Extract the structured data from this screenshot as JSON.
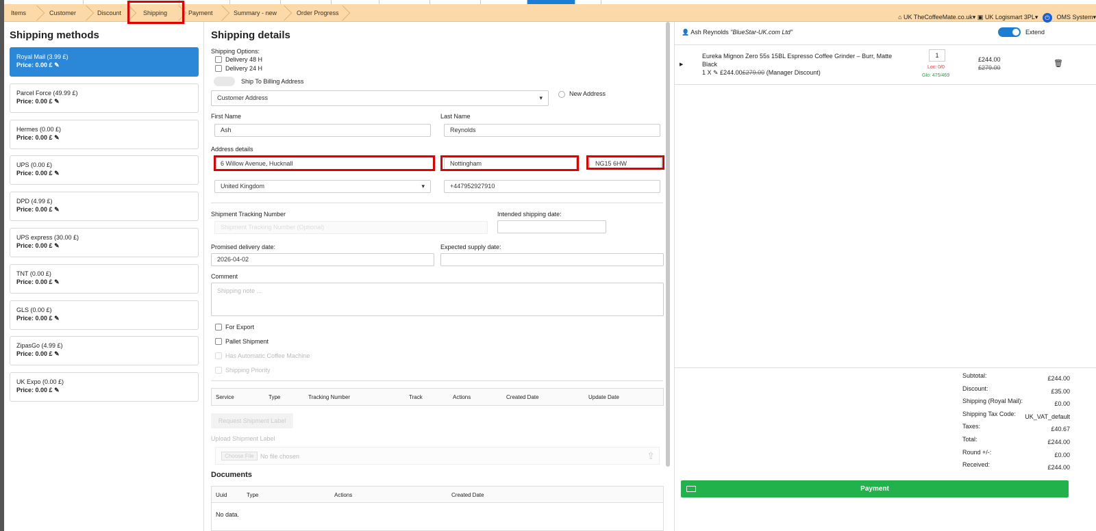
{
  "steps": [
    "Items",
    "Customer",
    "Discount",
    "Shipping",
    "Payment",
    "Summary - new",
    "Order Progress"
  ],
  "topright": {
    "store": "UK TheCoffeeMate.co.uk",
    "warehouse": "UK Logismart 3PL",
    "system": "OMS System"
  },
  "shipping_methods": {
    "title": "Shipping methods",
    "items": [
      {
        "name": "Royal Mail (3.99 £)",
        "price": "Price: 0.00 £"
      },
      {
        "name": "Parcel Force (49.99 £)",
        "price": "Price: 0.00 £"
      },
      {
        "name": "Hermes (0.00 £)",
        "price": "Price: 0.00 £"
      },
      {
        "name": "UPS (0.00 £)",
        "price": "Price: 0.00 £"
      },
      {
        "name": "DPD (4.99 £)",
        "price": "Price: 0.00 £"
      },
      {
        "name": "UPS express (30.00 £)",
        "price": "Price: 0.00 £"
      },
      {
        "name": "TNT (0.00 £)",
        "price": "Price: 0.00 £"
      },
      {
        "name": "GLS (0.00 £)",
        "price": "Price: 0.00 £"
      },
      {
        "name": "ZipasGo (4.99 £)",
        "price": "Price: 0.00 £"
      },
      {
        "name": "UK Expo (0.00 £)",
        "price": "Price: 0.00 £"
      }
    ]
  },
  "details": {
    "title": "Shipping details",
    "options_label": "Shipping Options:",
    "delivery48": "Delivery 48 H",
    "delivery24": "Delivery 24 H",
    "ship_to_billing": "Ship To Billing Address",
    "address_select": "Customer Address",
    "new_address": "New Address",
    "first_name_label": "First Name",
    "first_name": "Ash",
    "last_name_label": "Last Name",
    "last_name": "Reynolds",
    "address_label": "Address details",
    "street": "6 Willow Avenue, Hucknall",
    "city": "Nottingham",
    "postcode": "NG15 6HW",
    "country": "United Kingdom",
    "phone": "+447952927910",
    "tracking_label": "Shipment Tracking Number",
    "tracking_placeholder": "Shipment Tracking Number (Optional)",
    "intended_label": "Intended shipping date:",
    "promised_label": "Promised delivery date:",
    "promised": "2026-04-02",
    "expected_label": "Expected supply date:",
    "comment_label": "Comment",
    "comment_placeholder": "Shipping note ...",
    "for_export": "For Export",
    "pallet": "Pallet Shipment",
    "coffee_machine": "Has Automatic Coffee Machine",
    "priority": "Shipping Priority",
    "table_cols": [
      "Service",
      "Type",
      "Tracking Number",
      "Track",
      "Actions",
      "Created Date",
      "Update Date"
    ],
    "request_label_btn": "Request Shipment Label",
    "upload_label": "Upload Shipment Label",
    "choose_file": "Choose File",
    "no_file": "No file chosen",
    "documents_title": "Documents",
    "doc_cols": [
      "Uuid",
      "Type",
      "Actions",
      "Created Date"
    ],
    "no_data": "No data."
  },
  "cart": {
    "customer": "Ash Reynolds",
    "company": "\"BlueStar-UK.com Ltd\"",
    "extend": "Extend",
    "product_line1": "Eureka Mignon Zero 55s 15BL Espresso Coffee Grinder – Burr, Matte",
    "product_line2": "Black",
    "qty_prefix": "1 X",
    "unit_price": "£244.00",
    "unit_old": "£279.00",
    "discount_note": "(Manager Discount)",
    "qty": "1",
    "loc": "Loc: 0/0",
    "glo": "Glo: 475/469",
    "price": "£244.00",
    "price_old": "£279.00"
  },
  "totals": [
    {
      "label": "Subtotal:",
      "value": "£244.00"
    },
    {
      "label": "Discount:",
      "value": "£35.00"
    },
    {
      "label": "Shipping (Royal Mail):",
      "value": "£0.00"
    },
    {
      "label": "Shipping Tax Code:",
      "value": "UK_VAT_default"
    },
    {
      "label": "Taxes:",
      "value": "£40.67"
    },
    {
      "label": "Total:",
      "value": "£244.00"
    },
    {
      "label": "Round +/-:",
      "value": "£0.00"
    },
    {
      "label": "Received:",
      "value": "£244.00"
    }
  ],
  "payment_btn": "Payment",
  "colors": {
    "accent": "#2b88d8",
    "nav": "#fbd9a8",
    "highlight": "#e10000",
    "pay": "#22b24c"
  }
}
